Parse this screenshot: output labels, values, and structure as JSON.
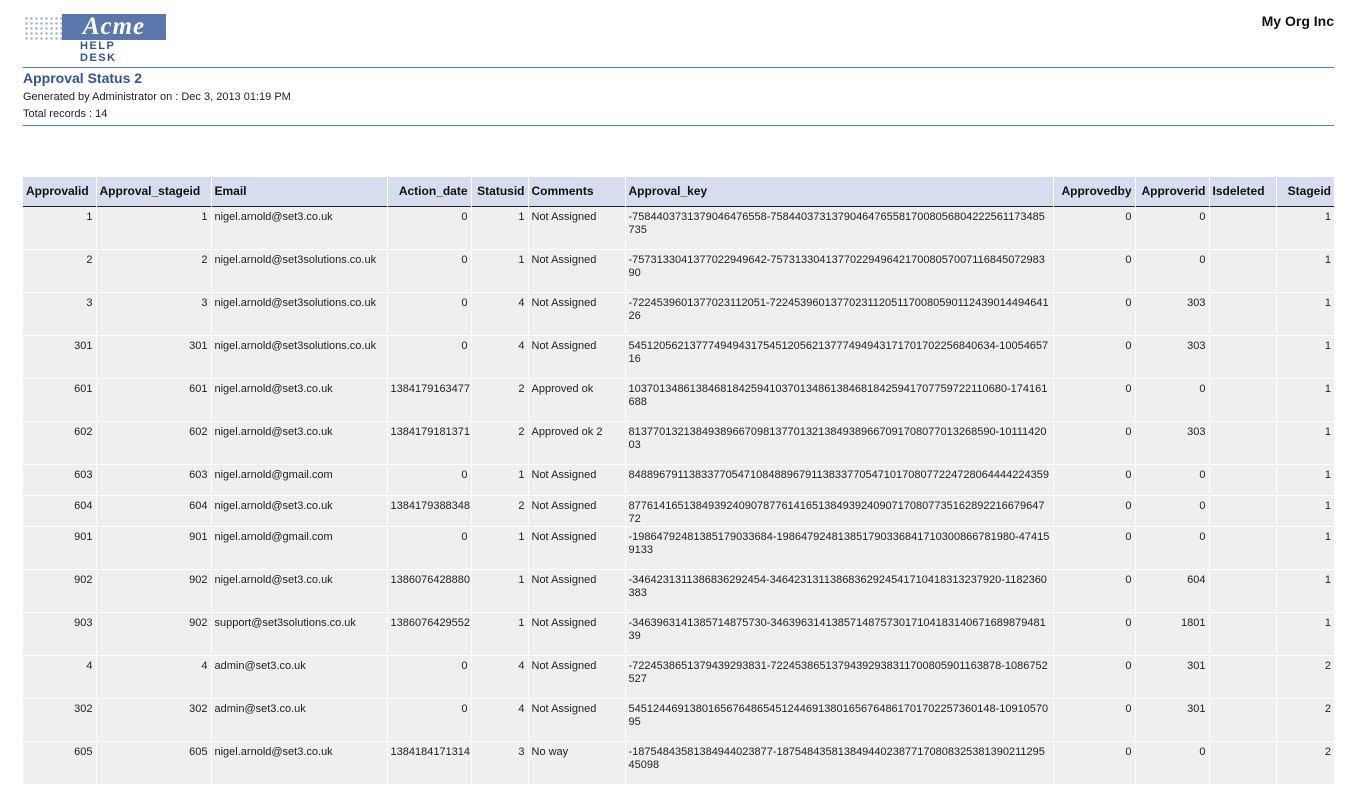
{
  "header": {
    "logo_text": "Acme",
    "logo_subtitle": "HELP DESK",
    "org_name": "My Org Inc"
  },
  "report": {
    "title": "Approval Status 2",
    "generated_label": "Generated by Administrator  on : Dec 3, 2013 01:19 PM",
    "total_records_label": "Total records : 14"
  },
  "table": {
    "columns": [
      "Approvalid",
      "Approval_stageid",
      "Email",
      "Action_date",
      "Statusid",
      "Comments",
      "Approval_key",
      "Approvedby",
      "Approverid",
      "Isdeleted",
      "Stageid"
    ],
    "rows": [
      [
        "1",
        "1",
        "nigel.arnold@set3.co.uk",
        "0",
        "1",
        "Not Assigned",
        "-7584403731379046476558-7584403731379046476558170080568042225611734857​35",
        "0",
        "0",
        "",
        "1"
      ],
      [
        "2",
        "2",
        "nigel.arnold@set3solutions.co.uk",
        "0",
        "1",
        "Not Assigned",
        "-7573133041377022949642-7573133041377022949642170080570071168450729839​0",
        "0",
        "0",
        "",
        "1"
      ],
      [
        "3",
        "3",
        "nigel.arnold@set3solutions.co.uk",
        "0",
        "4",
        "Not Assigned",
        "-7224539601377023112051-7224539601377023112051170080590112439014494641​26",
        "0",
        "303",
        "",
        "1"
      ],
      [
        "301",
        "301",
        "nigel.arnold@set3solutions.co.uk",
        "0",
        "4",
        "Not Assigned",
        "5451205621377749494317545120562137774949431717017022568406​34-1005465716",
        "0",
        "303",
        "",
        "1"
      ],
      [
        "601",
        "601",
        "nigel.arnold@set3.co.uk",
        "1384179163477",
        "2",
        "Approved ok",
        "103701348613846818425941037013486138468184259417077597221106​80-174161688",
        "0",
        "0",
        "",
        "1"
      ],
      [
        "602",
        "602",
        "nigel.arnold@set3.co.uk",
        "1384179181371",
        "2",
        "Approved ok 2",
        "813770132138493896670981377013213849389667091708077013268​590-1011142003",
        "0",
        "303",
        "",
        "1"
      ],
      [
        "603",
        "603",
        "nigel.arnold@gmail.com",
        "0",
        "1",
        "Not Assigned",
        "8488967911383377054710848896791138337705471017080772247280644442243​59",
        "0",
        "0",
        "",
        "1"
      ],
      [
        "604",
        "604",
        "nigel.arnold@set3.co.uk",
        "1384179388348",
        "2",
        "Not Assigned",
        "8776141651384939240907877614165138493924090717080773516289221667964​772",
        "0",
        "0",
        "",
        "1"
      ],
      [
        "901",
        "901",
        "nigel.arnold@gmail.com",
        "0",
        "1",
        "Not Assigned",
        "-1986479248138517903368​4-198647924813851790336841710300866781980-474159133",
        "0",
        "0",
        "",
        "1"
      ],
      [
        "902",
        "902",
        "nigel.arnold@set3.co.uk",
        "1386076428880",
        "1",
        "Not Assigned",
        "-3464231311386836292454-346423131138683629245417104183132379​20-1182360383",
        "0",
        "604",
        "",
        "1"
      ],
      [
        "903",
        "902",
        "support@set3solutions.co.uk",
        "1386076429552",
        "1",
        "Not Assigned",
        "-3463963141385714875730-3463963141385714875730171041831406716898794​8139",
        "0",
        "1801",
        "",
        "1"
      ],
      [
        "4",
        "4",
        "admin@set3.co.uk",
        "0",
        "4",
        "Not Assigned",
        "-7224538651379439293831-7224538651379439293831170080590116387​8-1086752527",
        "0",
        "301",
        "",
        "2"
      ],
      [
        "302",
        "302",
        "admin@set3.co.uk",
        "0",
        "4",
        "Not Assigned",
        "545124469138016567648654512446913801656764861701702257360148-1091057095",
        "0",
        "301",
        "",
        "2"
      ],
      [
        "605",
        "605",
        "nigel.arnold@set3.co.uk",
        "1384184171314",
        "3",
        "No way",
        "-1875484358138494402387​7-18754843581384944023877170808325381390211295450​98",
        "0",
        "0",
        "",
        "2"
      ]
    ]
  }
}
